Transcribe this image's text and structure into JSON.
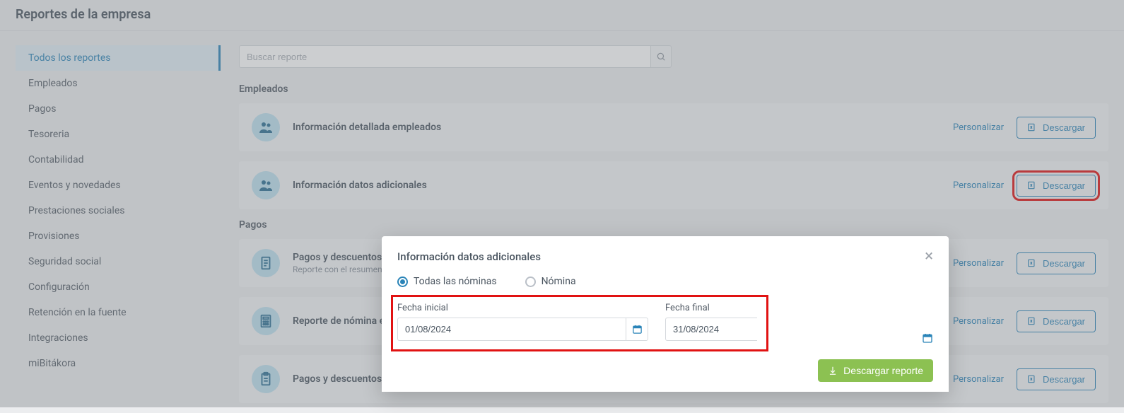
{
  "page": {
    "title": "Reportes de la empresa"
  },
  "sidebar": {
    "items": [
      {
        "label": "Todos los reportes",
        "active": true
      },
      {
        "label": "Empleados"
      },
      {
        "label": "Pagos"
      },
      {
        "label": "Tesoreria"
      },
      {
        "label": "Contabilidad"
      },
      {
        "label": "Eventos y novedades"
      },
      {
        "label": "Prestaciones sociales"
      },
      {
        "label": "Provisiones"
      },
      {
        "label": "Seguridad social"
      },
      {
        "label": "Configuración"
      },
      {
        "label": "Retención en la fuente"
      },
      {
        "label": "Integraciones"
      },
      {
        "label": "miBitákora"
      }
    ]
  },
  "search": {
    "placeholder": "Buscar reporte"
  },
  "sections": {
    "empleados": {
      "title": "Empleados",
      "reports": [
        {
          "title": "Información detallada empleados",
          "desc": ""
        },
        {
          "title": "Información datos adicionales",
          "desc": ""
        }
      ]
    },
    "pagos": {
      "title": "Pagos",
      "reports": [
        {
          "title": "Pagos y descuentos",
          "desc": "Reporte con el resumen de"
        },
        {
          "title": "Reporte de nómina elect",
          "desc": ""
        },
        {
          "title": "Pagos y descuentos incl",
          "desc": ""
        }
      ]
    }
  },
  "common": {
    "personalizar": "Personalizar",
    "descargar": "Descargar"
  },
  "modal": {
    "title": "Información datos adicionales",
    "radio": {
      "option1": "Todas las nóminas",
      "option2": "Nómina"
    },
    "date": {
      "inicial_label": "Fecha inicial",
      "inicial_value": "01/08/2024",
      "final_label": "Fecha final",
      "final_value": "31/08/2024"
    },
    "download": "Descargar reporte"
  },
  "colors": {
    "primary": "#2a84b8",
    "success": "#8cc152",
    "highlight": "#e11212"
  }
}
